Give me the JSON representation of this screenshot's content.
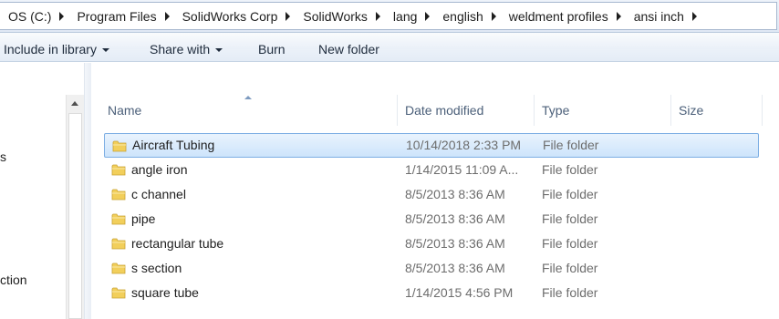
{
  "address_bar": {
    "crumbs": [
      "OS (C:)",
      "Program Files",
      "SolidWorks Corp",
      "SolidWorks",
      "lang",
      "english",
      "weldment profiles",
      "ansi inch"
    ]
  },
  "command_bar": {
    "include_in_library": "Include in library",
    "share_with": "Share with",
    "burn": "Burn",
    "new_folder": "New folder"
  },
  "nav_pane": {
    "partial_items": [
      "s",
      "ction"
    ]
  },
  "columns": {
    "name": "Name",
    "date_modified": "Date modified",
    "type": "Type",
    "size": "Size"
  },
  "files": [
    {
      "name": "Aircraft Tubing",
      "date": "10/14/2018 2:33 PM",
      "type": "File folder",
      "icon": "folder-icon",
      "selected": true
    },
    {
      "name": "angle iron",
      "date": "1/14/2015 11:09 A...",
      "type": "File folder",
      "icon": "folder-icon",
      "selected": false
    },
    {
      "name": "c channel",
      "date": "8/5/2013 8:36 AM",
      "type": "File folder",
      "icon": "folder-icon",
      "selected": false
    },
    {
      "name": "pipe",
      "date": "8/5/2013 8:36 AM",
      "type": "File folder",
      "icon": "folder-icon",
      "selected": false
    },
    {
      "name": "rectangular tube",
      "date": "8/5/2013 8:36 AM",
      "type": "File folder",
      "icon": "folder-icon",
      "selected": false
    },
    {
      "name": "s section",
      "date": "8/5/2013 8:36 AM",
      "type": "File folder",
      "icon": "folder-icon",
      "selected": false
    },
    {
      "name": "square tube",
      "date": "1/14/2015 4:56 PM",
      "type": "File folder",
      "icon": "folder-icon",
      "selected": false
    }
  ],
  "colors": {
    "selection_fill": "#cde4fb",
    "selection_border": "#7daee3",
    "header_text": "#4c607a",
    "secondary_text": "#6d6d6d",
    "folder_yellow": "#f2cf5b"
  }
}
